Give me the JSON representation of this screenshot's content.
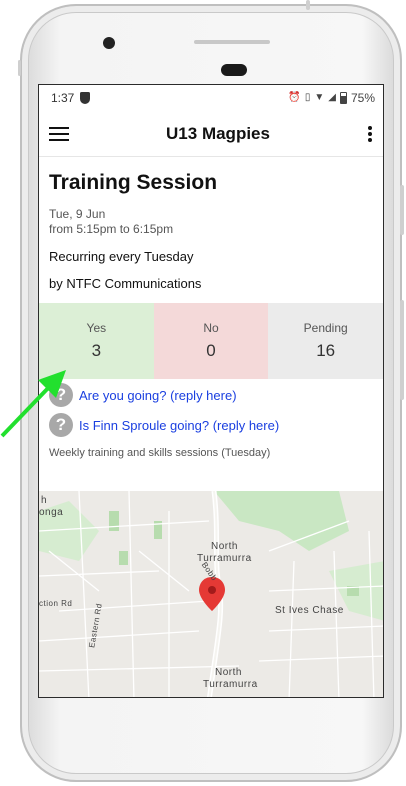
{
  "status": {
    "time": "1:37",
    "battery": "75%"
  },
  "appbar": {
    "title": "U13 Magpies"
  },
  "event": {
    "title": "Training Session",
    "date": "Tue, 9 Jun",
    "time_range": "from 5:15pm to 6:15pm",
    "recurrence": "Recurring every Tuesday",
    "organiser": "by NTFC Communications"
  },
  "rsvp": [
    {
      "label": "Yes",
      "count": "3",
      "color": "#dcefd6"
    },
    {
      "label": "No",
      "count": "0",
      "color": "#f4d9d9"
    },
    {
      "label": "Pending",
      "count": "16",
      "color": "#ebebeb"
    }
  ],
  "replies": {
    "self": "Are you going? (reply here)",
    "child": "Is Finn Sproule going? (reply here)"
  },
  "description": "Weekly training and skills sessions (Tuesday)",
  "map": {
    "labels": {
      "edge_h": "h",
      "edge_onga": "onga",
      "north": "North",
      "turramurra": "Turramurra",
      "bobbin": "Bobb",
      "ction_rd": "ction Rd",
      "eastern_rd": "Eastern Rd",
      "st_ives_chase": "St Ives Chase"
    },
    "pin_color": "#e53935"
  },
  "colors": {
    "link": "#1a3fe0",
    "arrow": "#22e02e"
  }
}
